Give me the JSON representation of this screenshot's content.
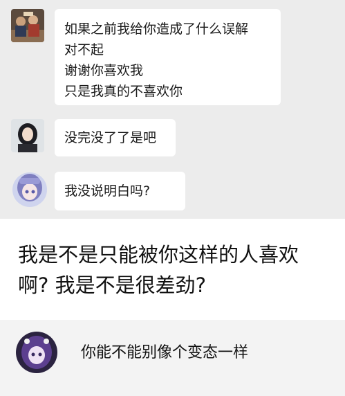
{
  "messages": [
    {
      "id": "m1",
      "avatar_icon": "group-photo-avatar-icon",
      "lines": [
        "如果之前我给你造成了什么误解",
        "对不起",
        "谢谢你喜欢我",
        "只是我真的不喜欢你"
      ]
    },
    {
      "id": "m2",
      "avatar_icon": "girl-photo-avatar-icon",
      "lines": [
        "没完没了了是吧"
      ]
    },
    {
      "id": "m3",
      "avatar_icon": "anime-girl-avatar-icon",
      "lines": [
        "我没说明白吗?"
      ]
    }
  ],
  "caption": {
    "lines": [
      "我是不是只能被你这样的人喜欢",
      "啊? 我是不是很差劲?"
    ]
  },
  "last_message": {
    "avatar_icon": "anime-skull-avatar-icon",
    "text": "你能不能别像个变态一样"
  },
  "colors": {
    "gray_band": "#ececec",
    "bubble": "#ffffff",
    "text": "#1a1a1a"
  }
}
